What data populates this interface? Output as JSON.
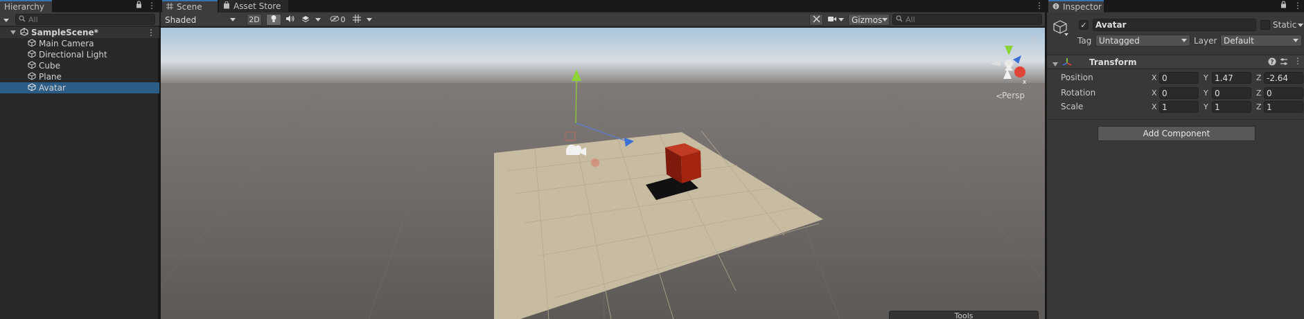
{
  "hierarchy": {
    "tab_label": "Hierarchy",
    "search_placeholder": "All",
    "scene_name": "SampleScene*",
    "items": [
      {
        "label": "Main Camera"
      },
      {
        "label": "Directional Light"
      },
      {
        "label": "Cube"
      },
      {
        "label": "Plane"
      },
      {
        "label": "Avatar",
        "selected": true
      }
    ]
  },
  "scene_view": {
    "tabs": [
      {
        "label": "Scene",
        "active": true
      },
      {
        "label": "Asset Store",
        "active": false
      }
    ],
    "shading_mode": "Shaded",
    "mode_2d": "2D",
    "hidden_count": "0",
    "gizmos_label": "Gizmos",
    "search_placeholder": "All",
    "persp_label": "Persp",
    "tools_overlay": "Tools",
    "colors": {
      "sky_top": "#a8c4dc",
      "ground": "#686361",
      "plane": "#c7bca1",
      "cube": "#a32410",
      "y_axis": "#8fd436"
    }
  },
  "inspector": {
    "tab_label": "Inspector",
    "object_name": "Avatar",
    "active_checked": true,
    "static_label": "Static",
    "tag_label": "Tag",
    "tag_value": "Untagged",
    "layer_label": "Layer",
    "layer_value": "Default",
    "component_title": "Transform",
    "transform": {
      "position": {
        "label": "Position",
        "x": "0",
        "y": "1.47",
        "z": "-2.64"
      },
      "rotation": {
        "label": "Rotation",
        "x": "0",
        "y": "0",
        "z": "0"
      },
      "scale": {
        "label": "Scale",
        "x": "1",
        "y": "1",
        "z": "1"
      }
    },
    "axis_labels": {
      "x": "X",
      "y": "Y",
      "z": "Z"
    },
    "add_component_label": "Add Component"
  }
}
